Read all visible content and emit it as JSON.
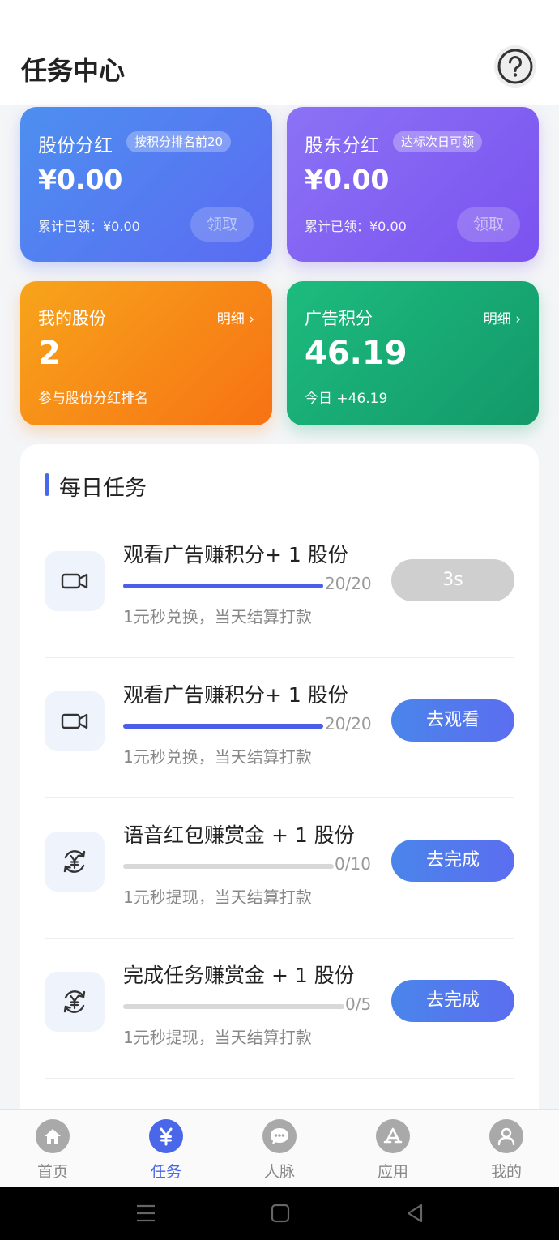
{
  "header": {
    "title": "任务中心",
    "help_icon": "question-circle-icon"
  },
  "cards": {
    "share_dividend": {
      "title": "股份分红",
      "tag": "按积分排名前20",
      "amount": "¥0.00",
      "claimed": "累计已领：¥0.00",
      "claim_label": "领取"
    },
    "holder_dividend": {
      "title": "股东分红",
      "tag": "达标次日可领",
      "amount": "¥0.00",
      "claimed": "累计已领：¥0.00",
      "claim_label": "领取"
    },
    "my_shares": {
      "title": "我的股份",
      "link": "明细 ›",
      "value": "2",
      "sub": "参与股份分红排名"
    },
    "ad_points": {
      "title": "广告积分",
      "link": "明细 ›",
      "value": "46.19",
      "sub": "今日 +46.19"
    }
  },
  "daily_tasks": {
    "title": "每日任务",
    "items": [
      {
        "title": "观看广告赚积分+ 1 股份",
        "progress": "20/20",
        "fraction": 1.0,
        "desc": "1元秒兑换，当天结算打款",
        "button": "3s",
        "icon": "video-camera-icon",
        "disabled": true
      },
      {
        "title": "观看广告赚积分+ 1 股份",
        "progress": "20/20",
        "fraction": 1.0,
        "desc": "1元秒兑换，当天结算打款",
        "button": "去观看",
        "icon": "video-camera-icon",
        "disabled": false
      },
      {
        "title": "语音红包赚赏金 + 1 股份",
        "progress": "0/10",
        "fraction": 0.0,
        "desc": "1元秒提现，当天结算打款",
        "button": "去完成",
        "icon": "yuan-exchange-icon",
        "disabled": false
      },
      {
        "title": "完成任务赚赏金 + 1 股份",
        "progress": "0/5",
        "fraction": 0.0,
        "desc": "1元秒提现，当天结算打款",
        "button": "去完成",
        "icon": "yuan-exchange-icon",
        "disabled": false
      }
    ]
  },
  "tabbar": {
    "items": [
      {
        "label": "首页",
        "icon": "home-icon"
      },
      {
        "label": "任务",
        "icon": "yuan-icon"
      },
      {
        "label": "人脉",
        "icon": "chat-icon"
      },
      {
        "label": "应用",
        "icon": "app-store-icon"
      },
      {
        "label": "我的",
        "icon": "user-icon"
      }
    ]
  },
  "colors": {
    "accent": "#4a67ea",
    "orange": "#f77214",
    "green": "#13996a",
    "purple": "#7b52f0"
  }
}
